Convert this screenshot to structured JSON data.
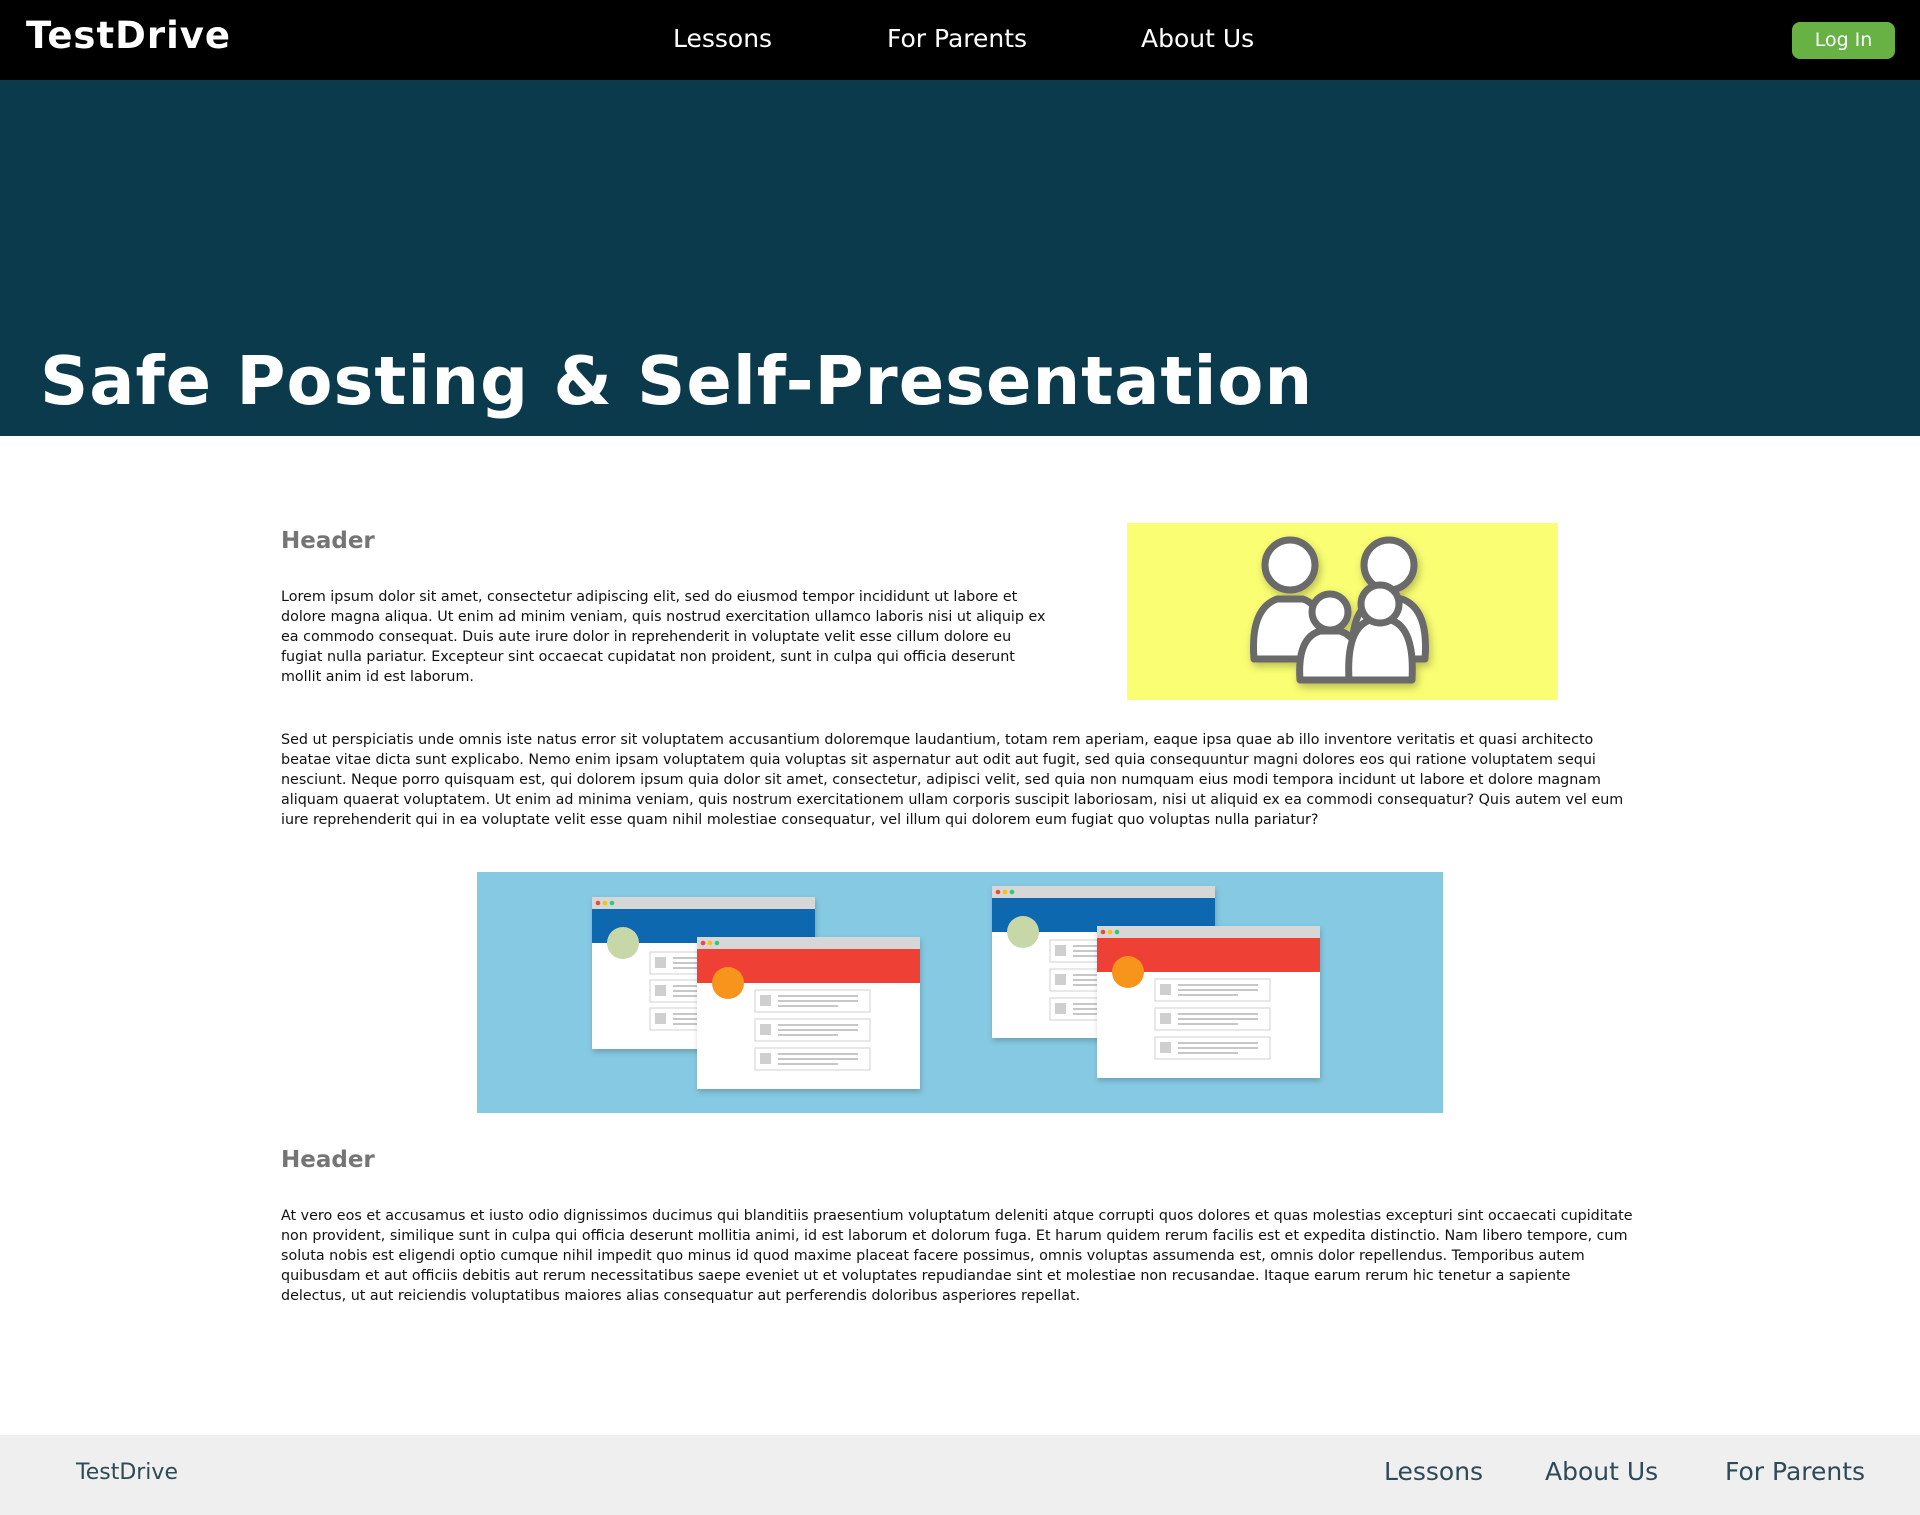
{
  "nav": {
    "logo": "TestDrive",
    "links": [
      "Lessons",
      "For Parents",
      "About Us"
    ],
    "login_label": "Log In",
    "login_color": "#68b144"
  },
  "hero": {
    "title": "Safe Posting & Self-Presentation",
    "background": "#0a3a4b"
  },
  "content": {
    "sections": [
      {
        "header": "Header",
        "paragraphs": [
          "Lorem ipsum dolor sit amet, consectetur adipiscing elit, sed do eiusmod tempor incididunt ut labore et dolore magna aliqua. Ut enim ad minim veniam, quis nostrud exercitation ullamco laboris nisi ut aliquip ex ea commodo consequat. Duis aute irure dolor in reprehenderit in voluptate velit esse cillum dolore eu fugiat nulla pariatur. Excepteur sint occaecat cupidatat non proident, sunt in culpa qui officia deserunt mollit anim id est laborum.",
          "Sed ut perspiciatis unde omnis iste natus error sit voluptatem accusantium doloremque laudantium, totam rem aperiam, eaque ipsa quae ab illo inventore veritatis et quasi architecto beatae vitae dicta sunt explicabo. Nemo enim ipsam voluptatem quia voluptas sit aspernatur aut odit aut fugit, sed quia consequuntur magni dolores eos qui ratione voluptatem sequi nesciunt. Neque porro quisquam est, qui dolorem ipsum quia dolor sit amet, consectetur, adipisci velit, sed quia non numquam eius modi tempora incidunt ut labore et dolore magnam aliquam quaerat voluptatem. Ut enim ad minima veniam, quis nostrum exercitationem ullam corporis suscipit laboriosam, nisi ut aliquid ex ea commodi consequatur? Quis autem vel eum iure reprehenderit qui in ea voluptate velit esse quam nihil molestiae consequatur, vel illum qui dolorem eum fugiat quo voluptas nulla pariatur?"
        ],
        "image_icon": "family-icon",
        "image_background": "#f9fe72"
      },
      {
        "header": "Header",
        "paragraphs": [
          "At vero eos et accusamus et iusto odio dignissimos ducimus qui blanditiis praesentium voluptatum deleniti atque corrupti quos dolores et quas molestias excepturi sint occaecati cupiditate non provident, similique sunt in culpa qui officia deserunt mollitia animi, id est laborum et dolorum fuga. Et harum quidem rerum facilis est et expedita distinctio. Nam libero tempore, cum soluta nobis est eligendi optio cumque nihil impedit quo minus id quod maxime placeat facere possimus, omnis voluptas assumenda est, omnis dolor repellendus. Temporibus autem quibusdam et aut officiis debitis aut rerum necessitatibus saepe eveniet ut et voluptates repudiandae sint et molestiae non recusandae. Itaque earum rerum hic tenetur a sapiente delectus, ut aut reiciendis voluptatibus maiores alias consequatur aut perferendis doloribus asperiores repellat."
        ]
      }
    ],
    "middle_image_icon": "browser-windows-illustration",
    "middle_image_background": "#86c9e2"
  },
  "footer": {
    "logo": "TestDrive",
    "links": [
      "Lessons",
      "About Us",
      "For Parents"
    ]
  }
}
